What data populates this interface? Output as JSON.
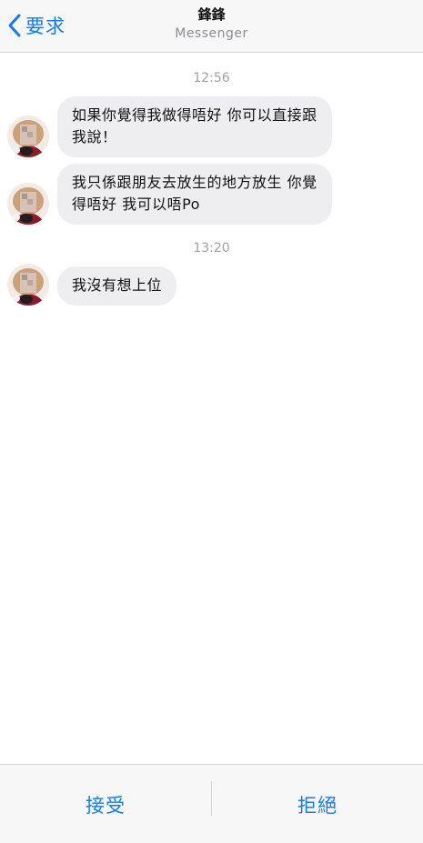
{
  "header": {
    "back_label": "要求",
    "title": "鋒鋒",
    "subtitle": "Messenger"
  },
  "conversation": {
    "groups": [
      {
        "time": "12:56",
        "messages": [
          {
            "text": "如果你覺得我做得唔好 你可以直接跟我說！"
          },
          {
            "text": "我只係跟朋友去放生的地方放生 你覺得唔好 我可以唔Po"
          }
        ]
      },
      {
        "time": "13:20",
        "messages": [
          {
            "text": "我沒有想上位"
          }
        ]
      }
    ]
  },
  "footer": {
    "accept_label": "接受",
    "decline_label": "拒絕"
  },
  "colors": {
    "accent": "#1a7ae6",
    "bubble": "#eeeef0",
    "bar": "#f7f7f8"
  }
}
